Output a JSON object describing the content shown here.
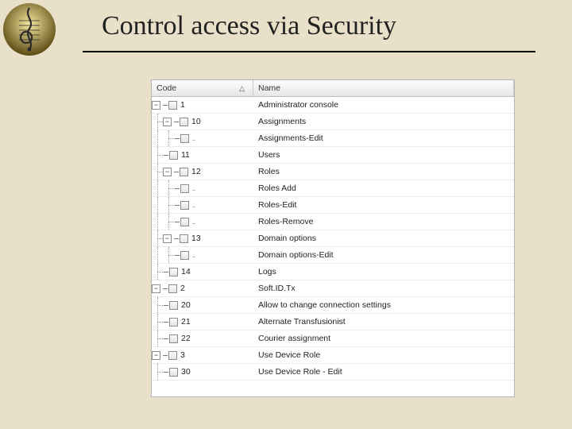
{
  "slide": {
    "title": "Control access via Security"
  },
  "table": {
    "columns": {
      "code": "Code",
      "name": "Name",
      "sort_indicator": "△"
    },
    "rows": [
      {
        "indent": 0,
        "exp": "-",
        "code": "1",
        "name": "Administrator console"
      },
      {
        "indent": 1,
        "exp": "-",
        "code": "10",
        "name": "Assignments"
      },
      {
        "indent": 2,
        "exp": "",
        "code": "",
        "name": "Assignments-Edit",
        "leaf": true
      },
      {
        "indent": 1,
        "exp": "",
        "code": "11",
        "name": "Users"
      },
      {
        "indent": 1,
        "exp": "-",
        "code": "12",
        "name": "Roles"
      },
      {
        "indent": 2,
        "exp": "",
        "code": "",
        "name": "Roles Add",
        "leaf": true
      },
      {
        "indent": 2,
        "exp": "",
        "code": "",
        "name": "Roles-Edit",
        "leaf": true
      },
      {
        "indent": 2,
        "exp": "",
        "code": "",
        "name": "Roles-Remove",
        "leaf": true
      },
      {
        "indent": 1,
        "exp": "-",
        "code": "13",
        "name": "Domain options"
      },
      {
        "indent": 2,
        "exp": "",
        "code": "",
        "name": "Domain options-Edit",
        "leaf": true
      },
      {
        "indent": 1,
        "exp": "",
        "code": "14",
        "name": "Logs"
      },
      {
        "indent": 0,
        "exp": "-",
        "code": "2",
        "name": "Soft.ID.Tx"
      },
      {
        "indent": 1,
        "exp": "",
        "code": "20",
        "name": "Allow to change connection settings",
        "dashleaf": true
      },
      {
        "indent": 1,
        "exp": "",
        "code": "21",
        "name": "Alternate Transfusionist",
        "dashleaf": true
      },
      {
        "indent": 1,
        "exp": "",
        "code": "22",
        "name": "Courier assignment",
        "dashleaf": true
      },
      {
        "indent": 0,
        "exp": "-",
        "code": "3",
        "name": "Use Device Role"
      },
      {
        "indent": 1,
        "exp": "",
        "code": "30",
        "name": "Use Device Role - Edit",
        "dashleaf": true
      }
    ]
  }
}
